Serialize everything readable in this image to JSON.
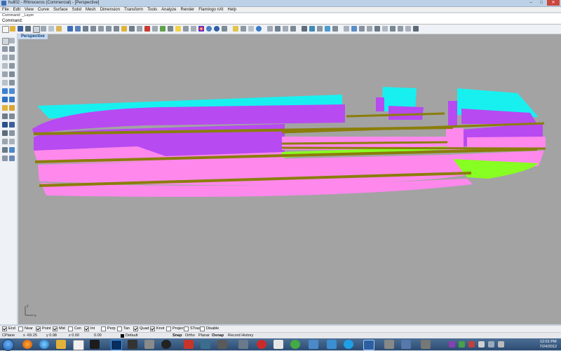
{
  "window": {
    "title": "hull02 - Rhinoceros (Commercial) - [Perspective]",
    "min_label": "–",
    "max_label": "□",
    "close_label": "✕"
  },
  "menu": [
    "File",
    "Edit",
    "View",
    "Curve",
    "Surface",
    "Solid",
    "Mesh",
    "Dimension",
    "Transform",
    "Tools",
    "Analyze",
    "Render",
    "Flamingo nXt",
    "Help"
  ],
  "command": {
    "history": "Command: _Layer",
    "label": "Command:",
    "value": ""
  },
  "viewport": {
    "tab_label": "Perspective",
    "axis_x": "x",
    "axis_y": "y"
  },
  "osnap": [
    {
      "label": "End",
      "checked": true
    },
    {
      "label": "Near",
      "checked": false
    },
    {
      "label": "Point",
      "checked": true
    },
    {
      "label": "Mid",
      "checked": true
    },
    {
      "label": "Cen",
      "checked": false
    },
    {
      "label": "Int",
      "checked": true
    },
    {
      "label": "Perp",
      "checked": false
    },
    {
      "label": "Tan",
      "checked": false
    },
    {
      "label": "Quad",
      "checked": true
    },
    {
      "label": "Knot",
      "checked": true
    },
    {
      "label": "Project",
      "checked": false
    },
    {
      "label": "STrack",
      "checked": false
    },
    {
      "label": "Disable",
      "checked": false
    }
  ],
  "status": {
    "cplane": "CPlane",
    "x": "x -69.25",
    "y": "y 0.98",
    "z": "z 0.00",
    "val": "0.00",
    "layer": "Default",
    "snap": "Snap",
    "ortho": "Ortho",
    "planar": "Planar",
    "osnap": "Osnap",
    "record": "Record History"
  },
  "clock": {
    "time": "12:01 PM",
    "date": "7/24/2012"
  },
  "colors": {
    "cyan": "#18f0f0",
    "purple": "#b84af2",
    "pink": "#ff88ec",
    "olive": "#8a7e0a",
    "green": "#88ff22",
    "viewport_bg": "#a3a3a3"
  }
}
